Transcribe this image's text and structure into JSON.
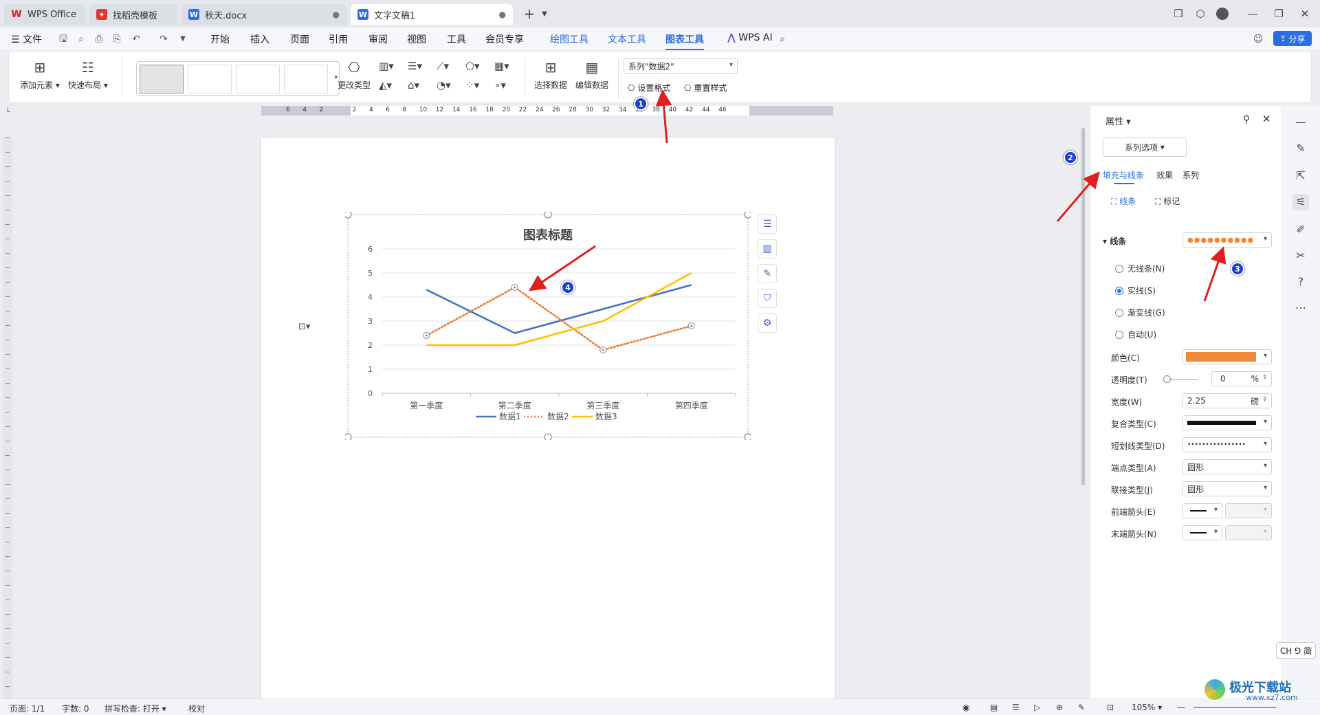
{
  "tabs": [
    {
      "label": "WPS Office",
      "icon": "wps-icon",
      "color": "#d9291c"
    },
    {
      "label": "找稻壳模板",
      "icon": "docer-icon",
      "color": "#e0382f"
    },
    {
      "label": "秋天.docx",
      "icon": "word-doc-icon",
      "color": "#2b6de3"
    },
    {
      "label": "文字文稿1",
      "icon": "word-doc-icon",
      "color": "#2b6de3"
    }
  ],
  "menu": {
    "file": "文件",
    "items": [
      "开始",
      "插入",
      "页面",
      "引用",
      "审阅",
      "视图",
      "工具",
      "会员专享"
    ],
    "context": [
      "绘图工具",
      "文本工具",
      "图表工具"
    ],
    "wps_ai": "WPS AI",
    "share": "分享"
  },
  "ribbon": {
    "add_element": "添加元素",
    "quick_layout": "快速布局",
    "change_type": "更改类型",
    "select_data": "选择数据",
    "edit_data": "编辑数据",
    "series_select": "系列\"数据2\"",
    "set_format": "设置格式",
    "reset_style": "重置样式"
  },
  "ruler": {
    "h_ticks": [
      "6",
      "4",
      "2",
      "",
      "2",
      "4",
      "6",
      "8",
      "10",
      "12",
      "14",
      "16",
      "18",
      "20",
      "22",
      "24",
      "26",
      "28",
      "30",
      "32",
      "34",
      "36",
      "38",
      "40",
      "42",
      "44",
      "46"
    ]
  },
  "chart_data": {
    "type": "line",
    "title": "图表标题",
    "categories": [
      "第一季度",
      "第二季度",
      "第三季度",
      "第四季度"
    ],
    "ylim": [
      0,
      6
    ],
    "yticks": [
      "0",
      "1",
      "2",
      "3",
      "4",
      "5",
      "6"
    ],
    "grid": true,
    "legend_position": "bottom",
    "series": [
      {
        "name": "数据1",
        "values": [
          4.3,
          2.5,
          3.5,
          4.5
        ],
        "color": "#4472c4",
        "dash": "solid"
      },
      {
        "name": "数据2",
        "values": [
          2.4,
          4.4,
          1.8,
          2.8
        ],
        "color": "#ed7d31",
        "dash": "dotted"
      },
      {
        "name": "数据3",
        "values": [
          2.0,
          2.0,
          3.0,
          5.0
        ],
        "color": "#ffc000",
        "dash": "solid"
      }
    ]
  },
  "panel": {
    "title": "属性",
    "series_options": "系列选项",
    "tabs": [
      "填充与线条",
      "效果",
      "系列"
    ],
    "subtabs": [
      "线条",
      "标记"
    ],
    "section": "线条",
    "radios": [
      "无线条(N)",
      "实线(S)",
      "渐变线(G)",
      "自动(U)"
    ],
    "selected_radio": "实线(S)",
    "rows": [
      {
        "label": "颜色(C)"
      },
      {
        "label": "透明度(T)",
        "value": "0",
        "unit": "%"
      },
      {
        "label": "宽度(W)",
        "value": "2.25",
        "unit": "磅"
      },
      {
        "label": "复合类型(C)"
      },
      {
        "label": "短划线类型(D)"
      },
      {
        "label": "端点类型(A)",
        "value": "圆形"
      },
      {
        "label": "联接类型(J)",
        "value": "圆形"
      },
      {
        "label": "前端箭头(E)"
      },
      {
        "label": "末端箭头(N)"
      }
    ],
    "line_color": "#f0883a"
  },
  "status": {
    "page": "页面: 1/1",
    "words": "字数: 0",
    "spell": "拼写检查: 打开",
    "proof": "校对",
    "zoom": "105%"
  },
  "ime": "CH ⅁ 简",
  "watermark": {
    "name": "极光下载站",
    "url": "www.xz7.com"
  },
  "annotations": [
    "1",
    "2",
    "3",
    "4"
  ]
}
